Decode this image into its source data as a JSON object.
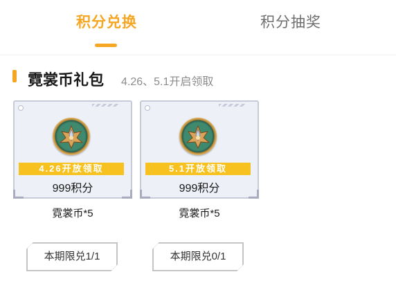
{
  "tabs": [
    {
      "label": "积分兑换",
      "active": true
    },
    {
      "label": "积分抽奖",
      "active": false
    }
  ],
  "section": {
    "title": "霓裳币礼包",
    "subtitle": "4.26、5.1开启领取"
  },
  "items": [
    {
      "banner": "4.26开放领取",
      "price": "999积分",
      "name": "霓裳币*5",
      "limit": "本期限兑1/1",
      "icon": "nichang-coin-icon"
    },
    {
      "banner": "5.1开放领取",
      "price": "999积分",
      "name": "霓裳币*5",
      "limit": "本期限兑0/1",
      "icon": "nichang-coin-icon"
    }
  ],
  "colors": {
    "accent": "#f5a623",
    "banner": "#f7c21f",
    "card_bg": "#eef0f8"
  }
}
